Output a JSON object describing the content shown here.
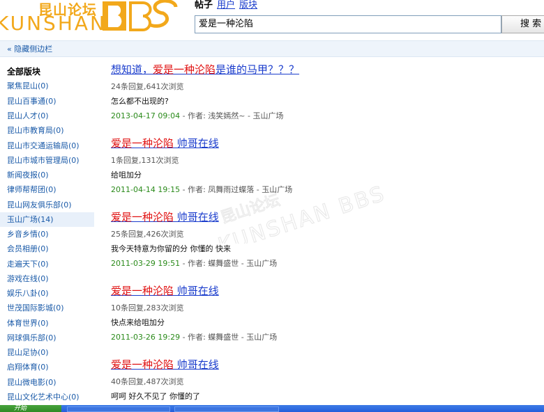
{
  "header": {
    "logo_cn": "昆山论坛",
    "logo_en": "KUNSHAN",
    "logo_bbs": "BBS",
    "tabs": [
      {
        "label": "帖子",
        "active": true
      },
      {
        "label": "用户",
        "active": false
      },
      {
        "label": "版块",
        "active": false
      }
    ],
    "search_value": "爱是一种沦陷",
    "search_button": "搜 索"
  },
  "toolbar": {
    "hide_sidebar": "« 隐藏侧边栏"
  },
  "sidebar": {
    "title": "全部版块",
    "items": [
      {
        "label": "聚焦昆山(0)",
        "active": false
      },
      {
        "label": "昆山百事通(0)",
        "active": false
      },
      {
        "label": "昆山人才(0)",
        "active": false
      },
      {
        "label": "昆山市教育局(0)",
        "active": false
      },
      {
        "label": "昆山市交通运输局(0)",
        "active": false
      },
      {
        "label": "昆山市城市管理局(0)",
        "active": false
      },
      {
        "label": "新闻夜报(0)",
        "active": false
      },
      {
        "label": "律师帮帮团(0)",
        "active": false
      },
      {
        "label": "昆山网友俱乐部(0)",
        "active": false
      },
      {
        "label": "玉山广场(14)",
        "active": true
      },
      {
        "label": "乡音乡情(0)",
        "active": false
      },
      {
        "label": "会员相册(0)",
        "active": false
      },
      {
        "label": "走遍天下(0)",
        "active": false
      },
      {
        "label": "游戏在线(0)",
        "active": false
      },
      {
        "label": "娱乐八卦(0)",
        "active": false
      },
      {
        "label": "世茂国际影城(0)",
        "active": false
      },
      {
        "label": "体育世界(0)",
        "active": false
      },
      {
        "label": "网球俱乐部(0)",
        "active": false
      },
      {
        "label": "昆山足协(0)",
        "active": false
      },
      {
        "label": "启翔体育(0)",
        "active": false
      },
      {
        "label": "昆山微电影(0)",
        "active": false
      },
      {
        "label": "昆山文化艺术中心(0)",
        "active": false
      }
    ]
  },
  "results": [
    {
      "title_pre": "想知道，",
      "title_hl": "爱是一种沦陷",
      "title_post": "是谁的马甲？？？",
      "meta": "24条回复,641次浏览",
      "snippet": "怎么都不出现的?",
      "date": "2013-04-17 09:04",
      "info": " - 作者: 浅笑嫣然~ - 玉山广场"
    },
    {
      "title_pre": "",
      "title_hl": "爱是一种沦陷",
      "title_post": " 帅哥在线",
      "meta": "1条回复,131次浏览",
      "snippet": "给咀加分",
      "date": "2011-04-14 19:15",
      "info": " - 作者: 凤舞雨过蝶落 - 玉山广场"
    },
    {
      "title_pre": "",
      "title_hl": "爱是一种沦陷",
      "title_post": " 帅哥在线",
      "meta": "25条回复,426次浏览",
      "snippet": "我今天特意为你留的分 你懂的 快来",
      "date": "2011-03-29 19:51",
      "info": " - 作者: 蝶舞盛世 - 玉山广场"
    },
    {
      "title_pre": "",
      "title_hl": "爱是一种沦陷",
      "title_post": " 帅哥在线",
      "meta": "10条回复,283次浏览",
      "snippet": "快点来给咀加分",
      "date": "2011-03-26 19:29",
      "info": " - 作者: 蝶舞盛世 - 玉山广场"
    },
    {
      "title_pre": "",
      "title_hl": "爱是一种沦陷",
      "title_post": " 帅哥在线",
      "meta": "40条回复,487次浏览",
      "snippet": "呵呵 好久不见了 你懂的了",
      "date": "",
      "info": ""
    }
  ],
  "watermark": {
    "cn": "昆山论坛",
    "en": "KUNSHAN BBS"
  },
  "taskbar": {
    "start": "开始"
  },
  "colors": {
    "accent": "#f2a81b",
    "link": "#1a3ccc",
    "highlight": "#e01010",
    "date": "#2a8a1a"
  }
}
